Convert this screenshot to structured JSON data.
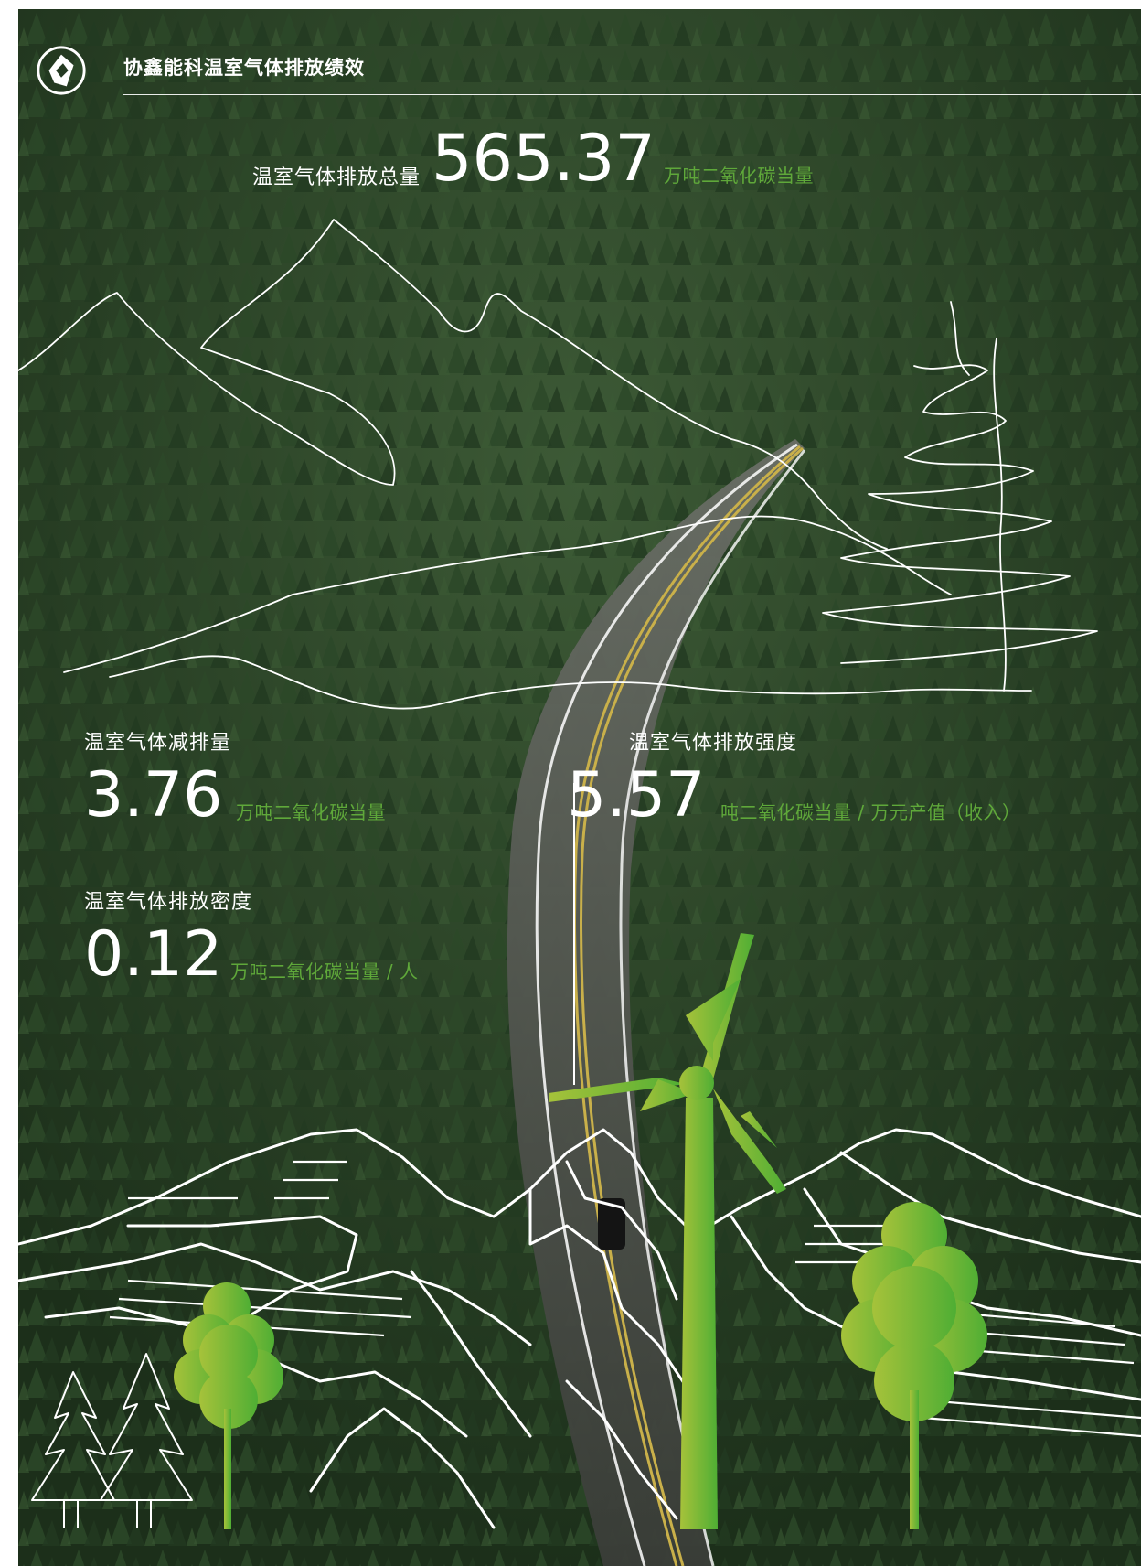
{
  "header": {
    "title": "协鑫能科温室气体排放绩效"
  },
  "total": {
    "label": "温室气体排放总量",
    "value": "565.37",
    "unit": "万吨二氧化碳当量"
  },
  "reduction": {
    "label": "温室气体减排量",
    "value": "3.76",
    "unit": "万吨二氧化碳当量"
  },
  "intensity": {
    "label": "温室气体排放强度",
    "value": "5.57",
    "unit": "吨二氧化碳当量 / 万元产值（收入）"
  },
  "density": {
    "label": "温室气体排放密度",
    "value": "0.12",
    "unit": "万吨二氧化碳当量 / 人"
  },
  "colors": {
    "accent_green": "#5fa83a",
    "forest_dark": "#1f331d",
    "text": "#ffffff"
  },
  "icons": [
    "company-logo-icon",
    "wind-turbine-icon",
    "tree-icon",
    "pine-tree-icon",
    "mountain-line-art"
  ]
}
